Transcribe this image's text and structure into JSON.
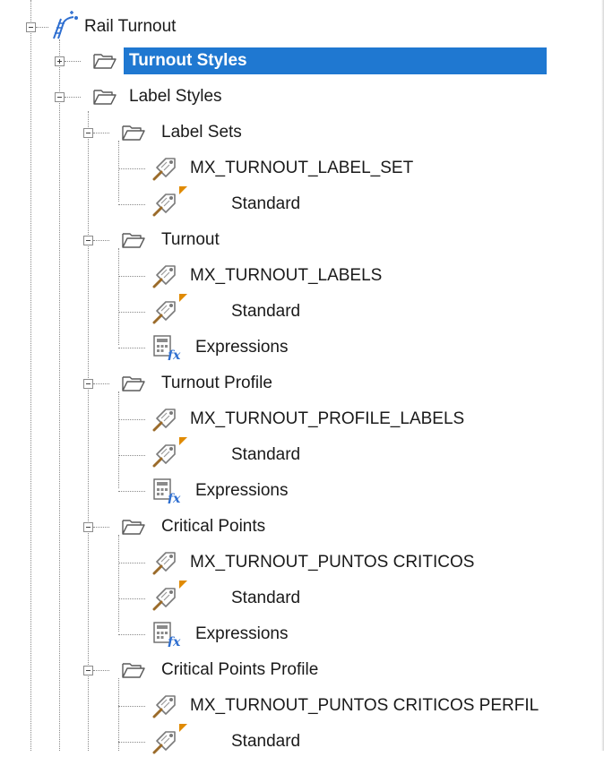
{
  "tree": {
    "root": {
      "label": "Rail Turnout",
      "icon": "rail-turnout-icon",
      "expanded": true
    },
    "items": [
      {
        "label": "Turnout Styles",
        "icon": "folder-icon",
        "expanded": false,
        "selected": true
      },
      {
        "label": "Label Styles",
        "icon": "folder-icon",
        "expanded": true
      },
      {
        "label": "Label Sets",
        "icon": "folder-icon",
        "expanded": true
      },
      {
        "label": "MX_TURNOUT_LABEL_SET",
        "icon": "label-style-icon"
      },
      {
        "label": "Standard",
        "icon": "label-style-default-icon"
      },
      {
        "label": "Turnout",
        "icon": "folder-icon",
        "expanded": true
      },
      {
        "label": "MX_TURNOUT_LABELS",
        "icon": "label-style-icon"
      },
      {
        "label": "Standard",
        "icon": "label-style-default-icon"
      },
      {
        "label": "Expressions",
        "icon": "expressions-icon"
      },
      {
        "label": "Turnout Profile",
        "icon": "folder-icon",
        "expanded": true
      },
      {
        "label": "MX_TURNOUT_PROFILE_LABELS",
        "icon": "label-style-icon"
      },
      {
        "label": "Standard",
        "icon": "label-style-default-icon"
      },
      {
        "label": "Expressions",
        "icon": "expressions-icon"
      },
      {
        "label": "Critical Points",
        "icon": "folder-icon",
        "expanded": true
      },
      {
        "label": "MX_TURNOUT_PUNTOS CRITICOS",
        "icon": "label-style-icon"
      },
      {
        "label": "Standard",
        "icon": "label-style-default-icon"
      },
      {
        "label": "Expressions",
        "icon": "expressions-icon"
      },
      {
        "label": "Critical Points Profile",
        "icon": "folder-icon",
        "expanded": true
      },
      {
        "label": "MX_TURNOUT_PUNTOS CRITICOS PERFIL",
        "icon": "label-style-icon"
      },
      {
        "label": "Standard",
        "icon": "label-style-default-icon"
      }
    ]
  },
  "colors": {
    "selection": "#1f78d1",
    "folder_stroke": "#5a5a5a",
    "label_icon_accent": "#9b6b2a",
    "default_marker": "#e08a00",
    "fx": "#2f6fd0"
  }
}
